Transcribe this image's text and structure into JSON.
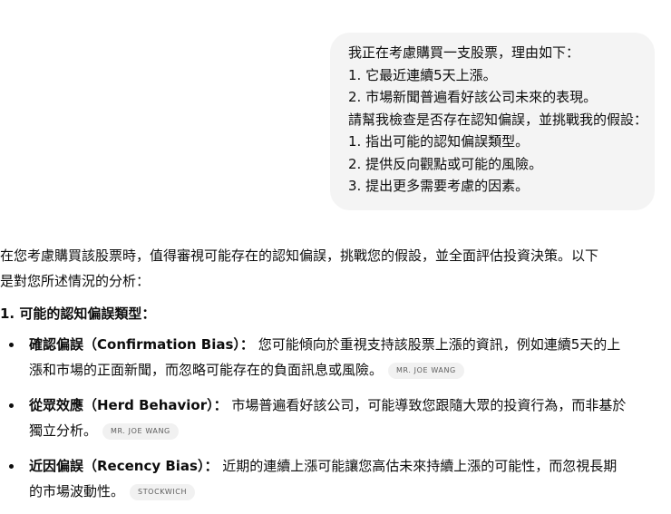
{
  "user_message": {
    "lines": [
      "我正在考慮購買一支股票，理由如下：",
      "1. 它最近連續5天上漲。",
      "2. 市場新聞普遍看好該公司未來的表現。",
      "請幫我檢查是否存在認知偏誤，並挑戰我的假設：",
      "1. 指出可能的認知偏誤類型。",
      "2. 提供反向觀點或可能的風險。",
      "3. 提出更多需要考慮的因素。"
    ]
  },
  "assistant": {
    "intro_line1": "在您考慮購買該股票時，值得審視可能存在的認知偏誤，挑戰您的假設，並全面評估投資決策。以下",
    "intro_line2": "是對您所述情況的分析：",
    "heading": "1. 可能的認知偏誤類型：",
    "bullets": [
      {
        "term": "確認偏誤（Confirmation Bias）：",
        "line1": "您可能傾向於重視支持該股票上漲的資訊，例如連續5天的上",
        "line2": "漲和市場的正面新聞，而忽略可能存在的負面訊息或風險。",
        "citation": "MR. JOE WANG"
      },
      {
        "term": "從眾效應（Herd Behavior）：",
        "line1": "市場普遍看好該公司，可能導致您跟隨大眾的投資行為，而非基於",
        "line2": "獨立分析。",
        "citation": "MR. JOE WANG"
      },
      {
        "term": "近因偏誤（Recency Bias）：",
        "line1": "近期的連續上漲可能讓您高估未來持續上漲的可能性，而忽視長期",
        "line2": "的市場波動性。",
        "citation": "STOCKWICH"
      }
    ]
  }
}
